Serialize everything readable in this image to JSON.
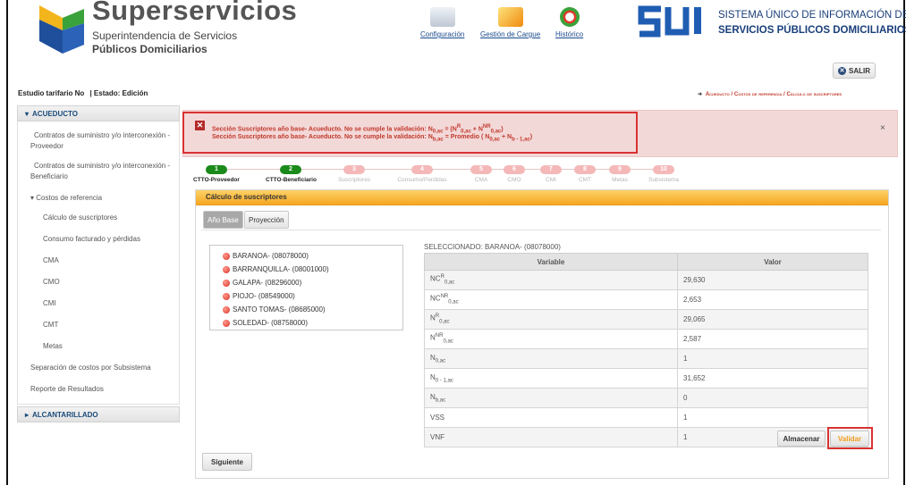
{
  "brand": {
    "title": "Superservicios",
    "subtitle_line1": "Superintendencia de Servicios",
    "subtitle_line2": "Públicos Domiciliarios",
    "colors": {
      "blue": "#1f4f9a",
      "yellow": "#f2b51c",
      "green": "#3aa23a"
    }
  },
  "top_nav": [
    {
      "label": "Configuración",
      "icon": "configuration-icon"
    },
    {
      "label": "Gestión de Cargue",
      "icon": "upload-management-icon"
    },
    {
      "label": "Histórico",
      "icon": "history-clock-icon"
    }
  ],
  "sui": {
    "line1": "SISTEMA ÚNICO DE INFORMACIÓN DE",
    "line2": "SERVICIOS PÚBLICOS DOMICILIARIOS"
  },
  "salir_label": "SALIR",
  "study": {
    "label": "Estudio tarifario No",
    "status": "| Estado: Edición"
  },
  "breadcrumb": "Acueducto / Costos de referencia / Cálculo de suscriptores",
  "sidebar": {
    "acueducto": "ACUEDUCTO",
    "items": [
      "Contratos de suministro y/o interconexión - Proveedor",
      "Contratos de suministro y/o interconexión - Beneficiario"
    ],
    "group": "Costos de referencia",
    "sub_items": [
      "Cálculo de suscriptores",
      "Consumo facturado y pérdidas",
      "CMA",
      "CMO",
      "CMI",
      "CMT",
      "Metas"
    ],
    "after_items": [
      "Separación de costos por Subsistema",
      "Reporte de Resultados"
    ],
    "alcantarillado": "ALCANTARILLADO"
  },
  "alert": {
    "prefix": "Sección Suscriptores año base- Acueducto. No se cumple la validación: ",
    "line1_rule": "N0,ac = (NR0,ac + NNR0,ac)",
    "line2_rule": "Nb,ac = Promedio ( N0,ac + Nb - 1,ac)",
    "close": "×"
  },
  "steps": [
    {
      "num": "1",
      "label": "CTTO-Proveedor",
      "active": true
    },
    {
      "num": "2",
      "label": "CTTO-Beneficiario",
      "active": true
    },
    {
      "num": "3",
      "label": "Suscriptores",
      "active": false
    },
    {
      "num": "4",
      "label": "Consumo/Perdidas",
      "active": false
    },
    {
      "num": "5",
      "label": "CMA",
      "active": false
    },
    {
      "num": "6",
      "label": "CMO",
      "active": false
    },
    {
      "num": "7",
      "label": "CMI",
      "active": false
    },
    {
      "num": "8",
      "label": "CMT",
      "active": false
    },
    {
      "num": "9",
      "label": "Metas",
      "active": false
    },
    {
      "num": "10",
      "label": "Subsistema",
      "active": false
    }
  ],
  "panel": {
    "title": "Cálculo de suscriptores",
    "tabs": [
      "Año Base",
      "Proyección"
    ],
    "municipalities": [
      "BARANOA- (08078000)",
      "BARRANQUILLA- (08001000)",
      "GALAPA- (08296000)",
      "PIOJO- (08549000)",
      "SANTO TOMAS- (08685000)",
      "SOLEDAD- (08758000)"
    ],
    "selected_label": "SELECCIONADO: BARANOA- (08078000)",
    "table_headers": [
      "Variable",
      "Valor"
    ],
    "values": [
      "29,630",
      "2,653",
      "29,065",
      "2,587",
      "1",
      "31,652",
      "0",
      "1",
      "1"
    ],
    "buttons": {
      "store": "Almacenar",
      "validate": "Validar",
      "next": "Siguiente"
    }
  }
}
